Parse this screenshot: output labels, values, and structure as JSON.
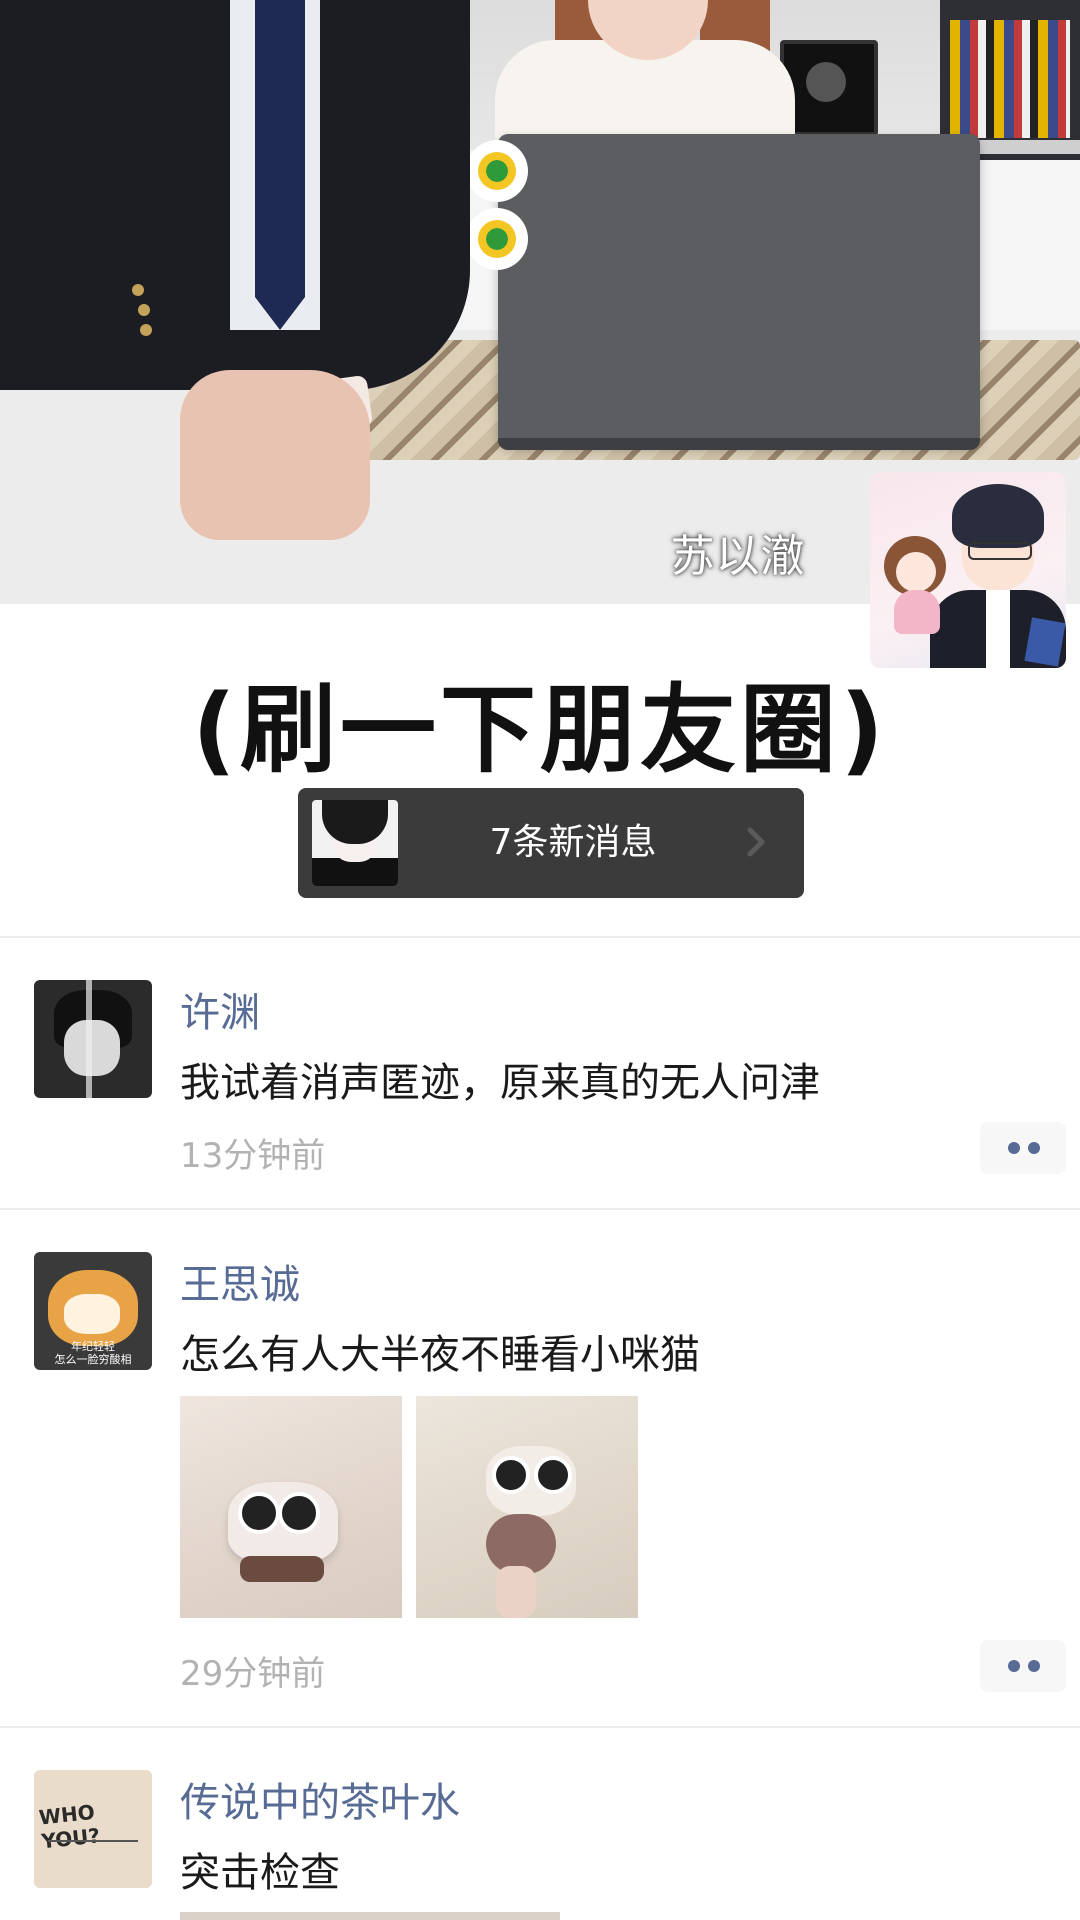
{
  "video": {
    "caption_name": "苏以澈"
  },
  "headline": "(刷一下朋友圈)",
  "new_messages": {
    "label": "7条新消息"
  },
  "posts": [
    {
      "username": "许渊",
      "text": "我试着消声匿迹，原来真的无人问津",
      "time": "13分钟前"
    },
    {
      "username": "王思诚",
      "text": "怎么有人大半夜不睡看小咪猫",
      "time": "29分钟前",
      "avatar_text_line1": "年纪轻轻",
      "avatar_text_line2": "怎么一脸穷酸相"
    },
    {
      "username": "传说中的茶叶水",
      "text": "突击检查",
      "avatar_text": "WHO YOU?"
    }
  ],
  "colors": {
    "link_blue": "#576b95",
    "time_gray": "#b2b2b2",
    "bar_dark": "#3b3b3b"
  }
}
